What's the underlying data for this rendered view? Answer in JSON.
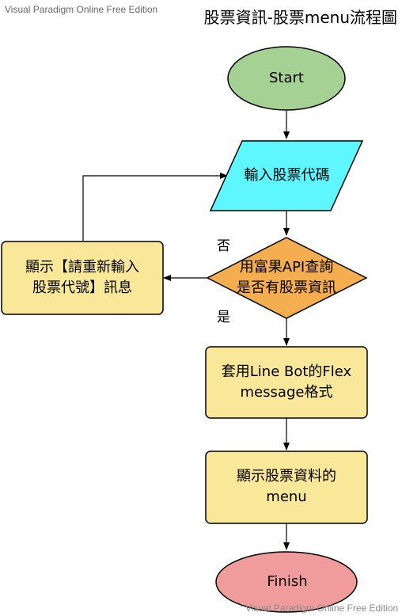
{
  "watermark": {
    "top": "Visual Paradigm Online Free Edition",
    "bottom": "Visual Paradigm Online Free Edition"
  },
  "title": "股票資訊-股票menu流程圖",
  "nodes": {
    "start": {
      "label": "Start",
      "shape": "ellipse",
      "fill": "#a6d195"
    },
    "input": {
      "label": "輸入股票代碼",
      "shape": "parallelogram",
      "fill": "#5ff7ff"
    },
    "decision": {
      "line1": "用富果API查詢",
      "line2": "是否有股票資訊",
      "shape": "diamond",
      "fill": "#f4ad4f"
    },
    "reenter": {
      "line1": "顯示【請重新輸入",
      "line2": "股票代號】訊息",
      "shape": "rounded-rect",
      "fill": "#f9e79a"
    },
    "flex": {
      "line1": "套用Line Bot的Flex",
      "line2": "message格式",
      "shape": "rounded-rect",
      "fill": "#f9e79a"
    },
    "menu": {
      "line1": "顯示股票資料的",
      "line2": "menu",
      "shape": "rounded-rect",
      "fill": "#f9e79a"
    },
    "finish": {
      "label": "Finish",
      "shape": "ellipse",
      "fill": "#f19c9c"
    }
  },
  "edges": {
    "no_label": "否",
    "yes_label": "是"
  },
  "colors": {
    "stroke": "#000000",
    "arrow": "#000000"
  }
}
